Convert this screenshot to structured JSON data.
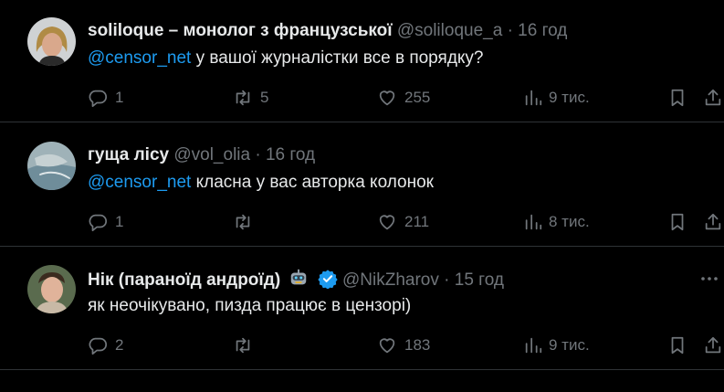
{
  "tweets": [
    {
      "name": "soliloque – монолог з французської",
      "handle": "@soliloque_a",
      "separator": "·",
      "time": "16 год",
      "mention": "@censor_net",
      "text": " у вашої журналістки все в порядку?",
      "replies": "1",
      "retweets": "5",
      "likes": "255",
      "views": "9 тис."
    },
    {
      "name": "гуща лісу",
      "handle": "@vol_olia",
      "separator": "·",
      "time": "16 год",
      "mention": "@censor_net",
      "text": " класна у вас авторка колонок",
      "replies": "1",
      "retweets": "",
      "likes": "211",
      "views": "8 тис."
    },
    {
      "name": "Нік (параноїд андроїд)",
      "handle": "@NikZharov",
      "separator": "·",
      "time": "15 год",
      "mention": "",
      "text": "як неочікувано, пизда працює в цензорі)",
      "replies": "2",
      "retweets": "",
      "likes": "183",
      "views": "9 тис.",
      "emoji": "robot-emoji",
      "verified": true
    }
  ],
  "colors": {
    "background": "#000000",
    "text": "#e7e9ea",
    "muted": "#71767b",
    "accent": "#1d9bf0",
    "divider": "#2f3336"
  },
  "icons": [
    "reply-icon",
    "retweet-icon",
    "heart-icon",
    "views-icon",
    "bookmark-icon",
    "share-icon",
    "more-icon",
    "verified-badge-icon",
    "robot-emoji"
  ]
}
